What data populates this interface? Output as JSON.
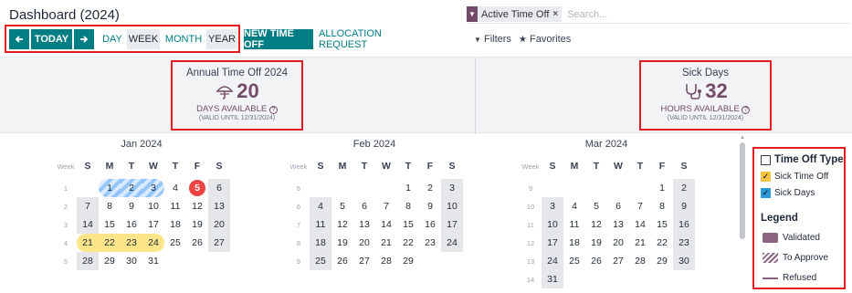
{
  "page": {
    "title": "Dashboard (2024)"
  },
  "search": {
    "facet": "Active Time Off",
    "placeholder": "Search..."
  },
  "toolbar": {
    "today": "TODAY",
    "scales": [
      "DAY",
      "WEEK",
      "MONTH",
      "YEAR"
    ],
    "active_scale": "WEEK",
    "new_time_off": "NEW TIME OFF",
    "allocation_request": "ALLOCATION REQUEST",
    "filters": "Filters",
    "favorites": "Favorites"
  },
  "summary": {
    "annual": {
      "title": "Annual Time Off 2024",
      "value": "20",
      "unit": "DAYS AVAILABLE",
      "valid": "(VALID UNTIL 12/31/2024)"
    },
    "sick": {
      "title": "Sick Days",
      "value": "32",
      "unit": "HOURS AVAILABLE",
      "valid": "(VALID UNTIL 12/31/2024)"
    }
  },
  "calendar": {
    "week_header": "Week",
    "day_headers": [
      "S",
      "M",
      "T",
      "W",
      "T",
      "F",
      "S"
    ],
    "months": [
      {
        "title": "Jan 2024",
        "weeks": [
          {
            "wk": "1",
            "days": [
              "",
              "1",
              "2",
              "3",
              "4",
              "5",
              "6"
            ]
          },
          {
            "wk": "2",
            "days": [
              "7",
              "8",
              "9",
              "10",
              "11",
              "12",
              "13"
            ]
          },
          {
            "wk": "3",
            "days": [
              "14",
              "15",
              "16",
              "17",
              "18",
              "19",
              "20"
            ]
          },
          {
            "wk": "4",
            "days": [
              "21",
              "22",
              "23",
              "24",
              "25",
              "26",
              "27"
            ]
          },
          {
            "wk": "5",
            "days": [
              "28",
              "29",
              "30",
              "31",
              "",
              "",
              ""
            ]
          }
        ],
        "today": "5",
        "to_approve": [
          "1",
          "2",
          "3"
        ],
        "validated": [
          "21",
          "22",
          "23",
          "24"
        ]
      },
      {
        "title": "Feb 2024",
        "weeks": [
          {
            "wk": "5",
            "days": [
              "",
              "",
              "",
              "",
              "1",
              "2",
              "3"
            ]
          },
          {
            "wk": "6",
            "days": [
              "4",
              "5",
              "6",
              "7",
              "8",
              "9",
              "10"
            ]
          },
          {
            "wk": "7",
            "days": [
              "11",
              "12",
              "13",
              "14",
              "15",
              "16",
              "17"
            ]
          },
          {
            "wk": "8",
            "days": [
              "18",
              "19",
              "20",
              "21",
              "22",
              "23",
              "24"
            ]
          },
          {
            "wk": "9",
            "days": [
              "25",
              "26",
              "27",
              "28",
              "29",
              "",
              ""
            ]
          }
        ]
      },
      {
        "title": "Mar 2024",
        "weeks": [
          {
            "wk": "9",
            "days": [
              "",
              "",
              "",
              "",
              "",
              "1",
              "2"
            ]
          },
          {
            "wk": "10",
            "days": [
              "3",
              "4",
              "5",
              "6",
              "7",
              "8",
              "9"
            ]
          },
          {
            "wk": "11",
            "days": [
              "10",
              "11",
              "12",
              "13",
              "14",
              "15",
              "16"
            ]
          },
          {
            "wk": "12",
            "days": [
              "17",
              "18",
              "19",
              "20",
              "21",
              "22",
              "23"
            ]
          },
          {
            "wk": "13",
            "days": [
              "24",
              "25",
              "26",
              "27",
              "28",
              "29",
              "30"
            ]
          },
          {
            "wk": "14",
            "days": [
              "31",
              "",
              "",
              "",
              "",
              "",
              ""
            ]
          }
        ]
      }
    ]
  },
  "sidepanel": {
    "type_header": "Time Off Type",
    "types": [
      {
        "label": "Sick Time Off",
        "checked": true,
        "color": "#f5c342"
      },
      {
        "label": "Sick Days",
        "checked": true,
        "color": "#2b9ad8"
      }
    ],
    "legend_header": "Legend",
    "legend": [
      {
        "label": "Validated",
        "icon": "solid-swatch"
      },
      {
        "label": "To Approve",
        "icon": "hatched-swatch"
      },
      {
        "label": "Refused",
        "icon": "line-swatch"
      }
    ]
  },
  "colors": {
    "accent": "#017e84",
    "brand": "#714b67",
    "today": "#ef4444",
    "validated": "#fde68a",
    "to_approve": "#93c5fd",
    "weekend": "#e5e7eb",
    "highlight_frame": "#e11d20"
  }
}
